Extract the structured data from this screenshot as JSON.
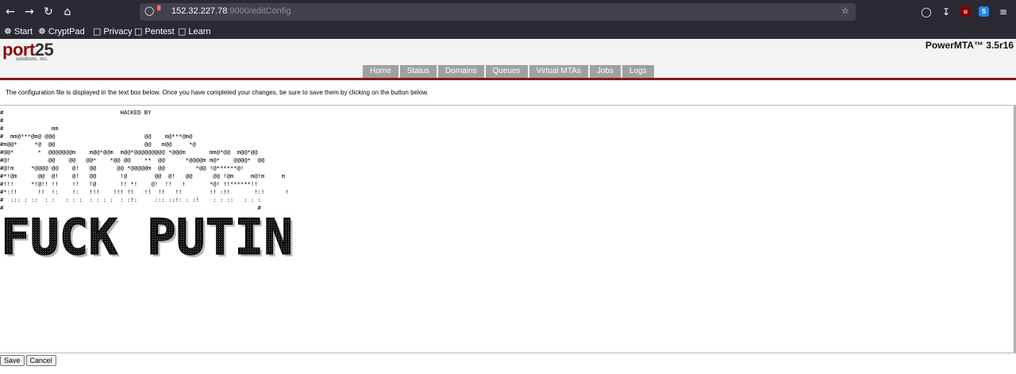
{
  "browser": {
    "url_host": "152.32.227.78",
    "url_path": ":9000/editConfig",
    "bookmarks": [
      "Start",
      "CryptPad",
      "Privacy",
      "Pentest",
      "Learn"
    ],
    "extension_badges": {
      "ublock": "u",
      "other": "S"
    }
  },
  "header": {
    "logo_main_1": "port",
    "logo_main_2": "25",
    "logo_sub": "solutions, inc.",
    "product": "PowerMTA™ 3.5r16",
    "tabs": [
      "Home",
      "Status",
      "Domains",
      "Queues",
      "Virtual MTAs",
      "Jobs",
      "Logs"
    ]
  },
  "intro": "The configuration file is displayed in the text box below. Once you have completed your changes, be sure to save them by clicking on the button below.",
  "editor": {
    "text": "#                                  HACKED BY\n#\n#              mm\n#  mm@***@m@ @@@                          @@    m@***@m@\n#m@@*     *@  @@                          @@   m@@     *@\n#@@*       *  @@@@@@@m    m@@*@@m  m@@*@@@@@@@@@ *@@@m       mm@*@@  m@@*@@\n#@!           @@    @@   @@*    *@@ @@    **  @@      *@@@@m m@*    @@@@*  @@\n#@!m     *@@@@ @@    @!   @@      @@ *@@@@@m  @@         *@@ !@******@!\n#*!@m      @@  @!    @!   @@       !@        @@  @!   @@      @@ !@m     m@!m     m\n#!!!     *!@!! !!    !!   !@       !! *!    @!  !!   !       *@! !!******!!\n#*:!!      !!  !:    !:   !!!    !!! !!   !!  !!   !!        !! :!!       !:!      !\n#  ::: : ::  : :   : : :  : : : :  : :!:     ::: ::!: : :!    : : ::   : : :\n#                                                                          #",
    "banner": "FUCK PUTIN"
  },
  "buttons": {
    "save": "Save",
    "cancel": "Cancel"
  }
}
